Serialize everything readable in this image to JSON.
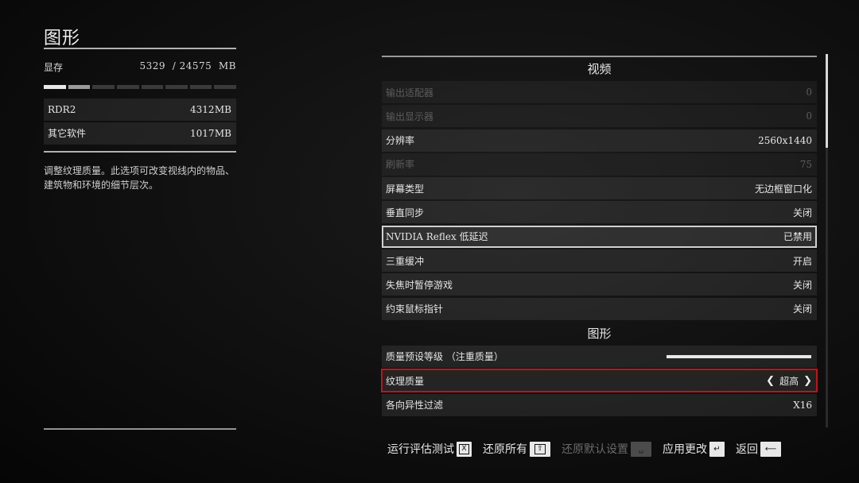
{
  "left": {
    "title": "图形",
    "vram": {
      "label": "显存",
      "used": "5329",
      "separator": "/",
      "total": "24575",
      "unit": "MB"
    },
    "vram_fraction": 0.217,
    "usage": [
      {
        "name": "RDR2",
        "value": "4312",
        "unit": "MB"
      },
      {
        "name": "其它软件",
        "value": "1017",
        "unit": "MB"
      }
    ],
    "description": "调整纹理质量。此选项可改变视线内的物品、建筑物和环境的细节层次。"
  },
  "video": {
    "section_title": "视频",
    "rows": [
      {
        "label": "输出适配器",
        "value": "0"
      },
      {
        "label": "输出显示器",
        "value": "0"
      },
      {
        "label": "分辨率",
        "value": "2560x1440"
      },
      {
        "label": "刷新率",
        "value": "75"
      },
      {
        "label": "屏幕类型",
        "value": "无边框窗口化"
      },
      {
        "label": "垂直同步",
        "value": "关闭"
      },
      {
        "label": "NVIDIA Reflex 低延迟",
        "value": "已禁用"
      },
      {
        "label": "三重缓冲",
        "value": "开启"
      },
      {
        "label": "失焦时暂停游戏",
        "value": "关闭"
      },
      {
        "label": "约束鼠标指针",
        "value": "关闭"
      }
    ]
  },
  "graphics": {
    "section_title": "图形",
    "rows": [
      {
        "label": "质量预设等级 （注重质量）",
        "slider_fraction": 1.0
      },
      {
        "label": "纹理质量",
        "value": "超高"
      },
      {
        "label": "各向异性过滤",
        "value": "X16"
      }
    ]
  },
  "actions": {
    "benchmark": {
      "label": "运行评估测试",
      "key": "X"
    },
    "reset_all": {
      "label": "还原所有",
      "key": "⇧"
    },
    "restore_default": {
      "label": "还原默认设置",
      "key": "␣"
    },
    "apply": {
      "label": "应用更改",
      "key": "↵"
    },
    "back": {
      "label": "返回",
      "key": "⟵"
    }
  },
  "scroll_fraction": 0.25
}
